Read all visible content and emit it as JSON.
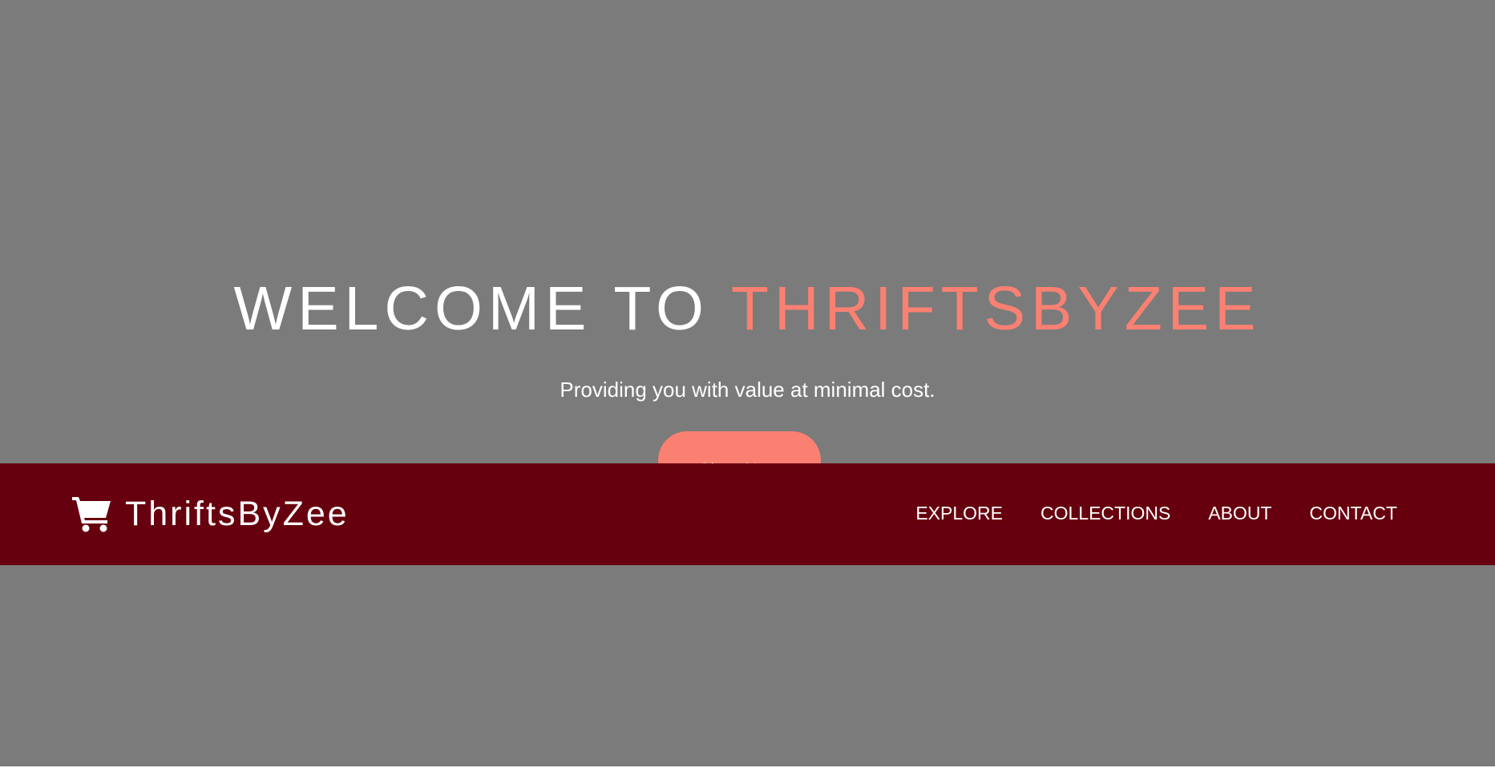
{
  "colors": {
    "hero_background": "#7b7b7b",
    "accent": "#fa8072",
    "navbar_background": "#67000e",
    "text": "#ffffff"
  },
  "hero": {
    "title_prefix": "WELCOME TO ",
    "title_accent": "THRIFTSBYZEE",
    "subtitle": "Providing you with value at minimal cost.",
    "cta_label": "Shop Now"
  },
  "navbar": {
    "brand_icon": "shopping-cart-icon",
    "brand_name": "ThriftsByZee",
    "links": [
      {
        "label": "EXPLORE"
      },
      {
        "label": "COLLECTIONS"
      },
      {
        "label": "ABOUT"
      },
      {
        "label": "CONTACT"
      }
    ]
  }
}
